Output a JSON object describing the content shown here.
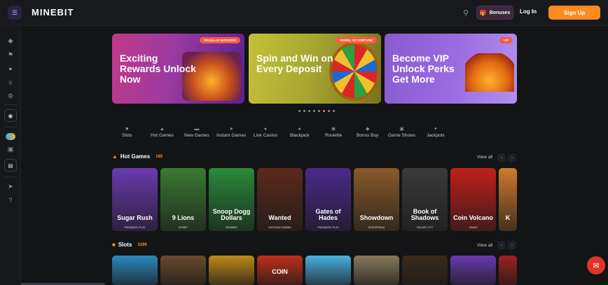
{
  "header": {
    "menu_icon": "collapse-menu-icon",
    "logo": "MINEBIT",
    "bonuses_label": "Bonuses",
    "login_label": "Log In",
    "signup_label": "Sign Up",
    "accent": "#ff8a1f"
  },
  "sidebar": {
    "icons": [
      "diamond-icon",
      "flag-icon",
      "trophy-icon",
      "crown-icon",
      "gear-icon",
      "headset-icon",
      "currency-toggle-icon",
      "wallet-icon",
      "document-icon",
      "share-icon",
      "help-icon"
    ]
  },
  "banners": [
    {
      "title": "Exciting Rewards Unlock Now",
      "badge": "REGULAR BONUSES"
    },
    {
      "title": "Spin and Win on Every Deposit",
      "badge": "WHEEL OF FORTUNE"
    },
    {
      "title": "Become VIP Unlock Perks Get More",
      "badge": "VIP"
    }
  ],
  "carousel": {
    "count": 8,
    "active_index": 5
  },
  "categories": [
    {
      "label": "Slots",
      "icon": "slots-icon"
    },
    {
      "label": "Hot Games",
      "icon": "fire-icon"
    },
    {
      "label": "New Games",
      "icon": "new-icon"
    },
    {
      "label": "Instant Games",
      "icon": "rocket-icon"
    },
    {
      "label": "Live Casino",
      "icon": "dealer-icon"
    },
    {
      "label": "Blackjack",
      "icon": "cards-icon"
    },
    {
      "label": "Roulette",
      "icon": "roulette-icon"
    },
    {
      "label": "Bonus Buy",
      "icon": "tag-icon"
    },
    {
      "label": "Game Shows",
      "icon": "tv-icon"
    },
    {
      "label": "Jackpots",
      "icon": "jackpot-icon"
    }
  ],
  "hot_games": {
    "title": "Hot Games",
    "count": "185",
    "view_all": "View all",
    "games": [
      {
        "name": "Sugar Rush",
        "provider": "PRAGMATIC PLAY",
        "bg": "#6a3ab0"
      },
      {
        "name": "9 Lions",
        "provider": "LEOBET",
        "bg": "#3a7a30"
      },
      {
        "name": "Snoop Dogg Dollars",
        "provider": "BGAMING",
        "bg": "#2a8a3a"
      },
      {
        "name": "Wanted",
        "provider": "HACKSAW GAMING",
        "bg": "#5a2a1a"
      },
      {
        "name": "Gates of Hades",
        "provider": "PRAGMATIC PLAY",
        "bg": "#4a2a8a"
      },
      {
        "name": "Showdown",
        "provider": "ENDORPHINA",
        "bg": "#8a5a2a"
      },
      {
        "name": "Book of Shadows",
        "provider": "NOLIMIT CITY",
        "bg": "#3a3a3a"
      },
      {
        "name": "Coin Volcano",
        "provider": "3OAKS",
        "bg": "#c0201a"
      },
      {
        "name": "K",
        "provider": "",
        "bg": "#d07a30"
      }
    ]
  },
  "slots": {
    "title": "Slots",
    "count": "3299",
    "view_all": "View all",
    "games": [
      {
        "name": "",
        "bg": "#2a8ac0"
      },
      {
        "name": "",
        "bg": "#6a4a2a"
      },
      {
        "name": "",
        "bg": "#c08a1a"
      },
      {
        "name": "COIN",
        "bg": "#c0301a"
      },
      {
        "name": "",
        "bg": "#4ab0e0"
      },
      {
        "name": "",
        "bg": "#8a7a5a"
      },
      {
        "name": "",
        "bg": "#3a2a1a"
      },
      {
        "name": "",
        "bg": "#6a3ab0"
      },
      {
        "name": "",
        "bg": "#a02020"
      }
    ]
  },
  "chat_icon": "chat-bubble-icon"
}
